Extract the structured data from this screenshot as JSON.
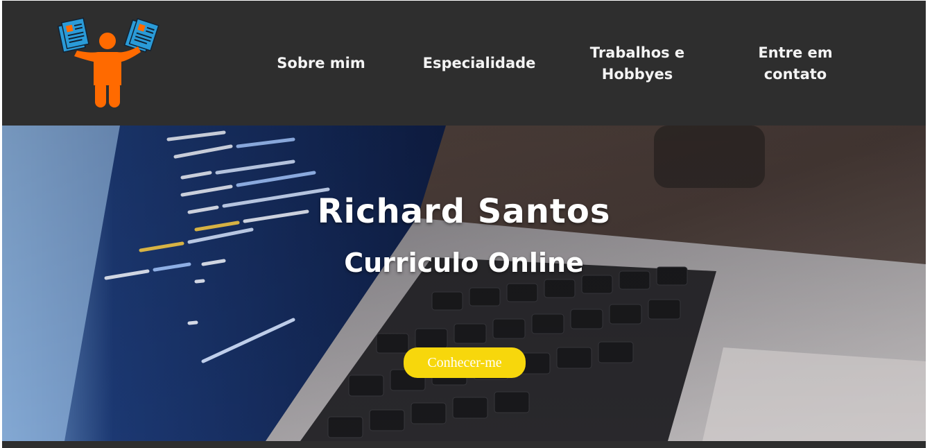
{
  "nav": {
    "items": [
      {
        "label": "Sobre mim"
      },
      {
        "label": "Especialidade"
      },
      {
        "label": "Trabalhos e Hobbyes"
      },
      {
        "label": "Entre em contato"
      }
    ]
  },
  "hero": {
    "title": "Richard Santos",
    "subtitle": "Curriculo Online",
    "cta_label": "Conhecer-me"
  },
  "colors": {
    "navbar": "#2e2e2e",
    "logo_person": "#ff6a00",
    "logo_papers": "#2a9bd8",
    "cta": "#f7d70c"
  }
}
